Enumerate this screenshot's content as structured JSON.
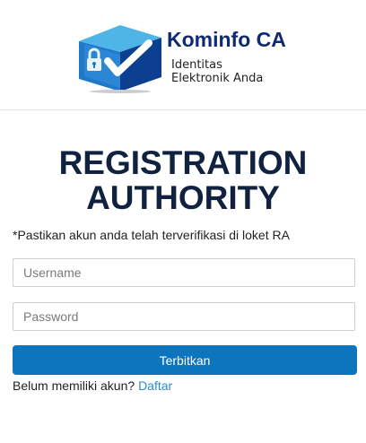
{
  "header": {
    "brand_title": "Kominfo CA",
    "brand_subtitle_line1": "Identitas",
    "brand_subtitle_line2": "Elektronik Anda",
    "logo_icon": "shield-lock-check-icon"
  },
  "main": {
    "title_line1": "REGISTRATION",
    "title_line2": "AUTHORITY",
    "notice": "*Pastikan akun anda telah terverifikasi di loket RA",
    "username_placeholder": "Username",
    "password_placeholder": "Password",
    "submit_label": "Terbitkan",
    "signup_text": "Belum memiliki akun? ",
    "signup_link": "Daftar"
  },
  "colors": {
    "brand": "#0f2a74",
    "button": "#0c75be",
    "link": "#2a8bd1",
    "title": "#10223f"
  }
}
